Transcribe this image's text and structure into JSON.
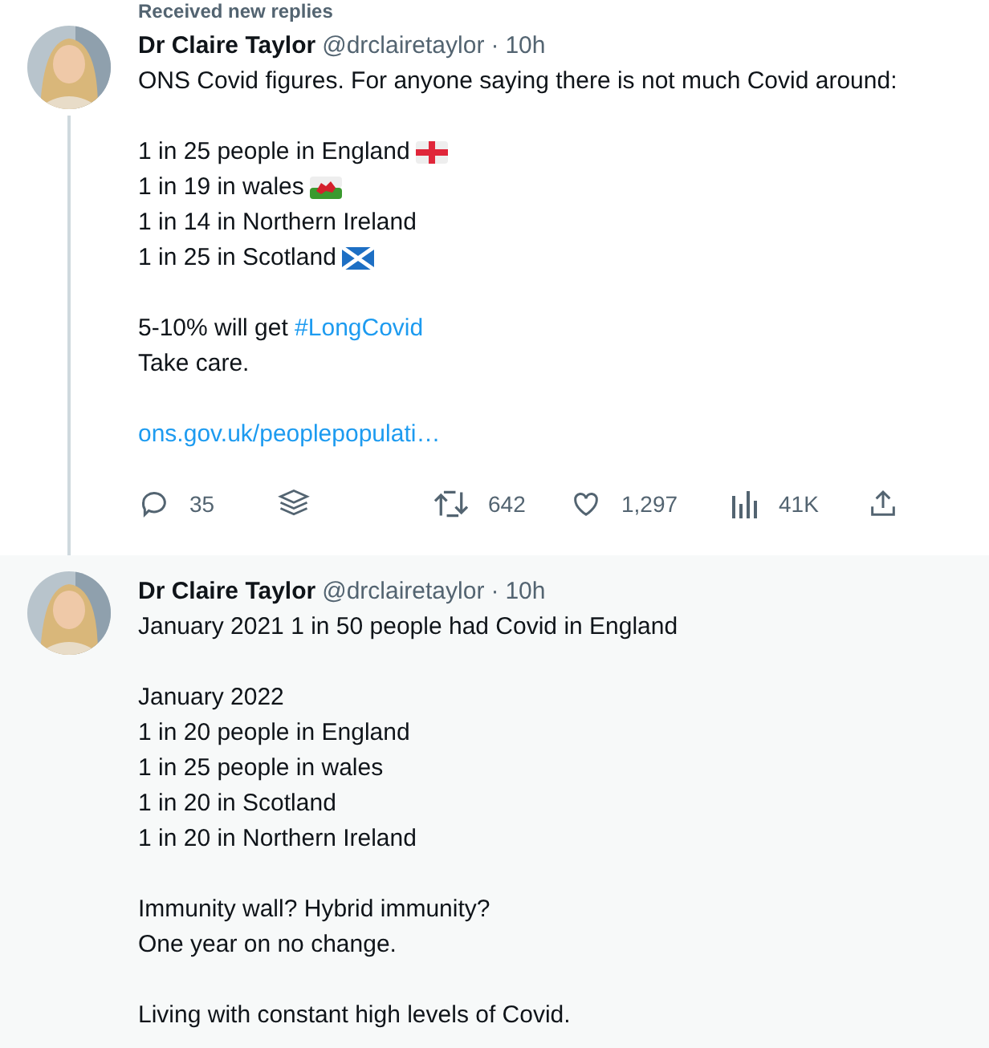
{
  "notice": {
    "text": "Received new replies"
  },
  "tweets": [
    {
      "author": "Dr Claire Taylor",
      "handle": "@drclairetaylor",
      "separator": "·",
      "time": "10h",
      "thread_line": true,
      "paragraphs": [
        [
          {
            "text": "ONS Covid figures. For anyone saying there is not much Covid around:"
          }
        ],
        [
          {
            "text": "1 in 25 people in England",
            "kind": "england"
          },
          {
            "text": "1 in 19 in wales",
            "kind": "wales"
          },
          {
            "text": "1 in 14 in Northern Ireland",
            "kind": "plain"
          },
          {
            "text": "1 in 25 in Scotland",
            "kind": "scotland"
          }
        ],
        [
          {
            "text": "5-10% will get ",
            "hashtag": "#LongCovid"
          },
          {
            "text": "Take care."
          }
        ],
        [
          {
            "link": "ons.gov.uk/peoplepopulati…"
          }
        ]
      ],
      "actions": [
        {
          "kind": "reply",
          "count": "35"
        },
        {
          "kind": "layers"
        },
        {
          "kind": "retweet",
          "count": "642"
        },
        {
          "kind": "like",
          "count": "1,297"
        },
        {
          "kind": "views",
          "count": "41K"
        },
        {
          "kind": "share"
        }
      ]
    },
    {
      "author": "Dr Claire Taylor",
      "handle": "@drclairetaylor",
      "separator": "·",
      "time": "10h",
      "thread_line": false,
      "paragraphs": [
        [
          {
            "text": "January 2021 1 in 50 people had Covid in England"
          }
        ],
        [
          {
            "text": "January 2022"
          },
          {
            "text": "1 in 20 people in England"
          },
          {
            "text": "1 in 25 people in wales"
          },
          {
            "text": "1 in 20 in Scotland"
          },
          {
            "text": "1 in 20 in Northern Ireland"
          }
        ],
        [
          {
            "text": "Immunity wall? Hybrid immunity?"
          },
          {
            "text": "One year on no change."
          }
        ],
        [
          {
            "text": "Living with constant high levels of Covid."
          }
        ]
      ]
    }
  ]
}
